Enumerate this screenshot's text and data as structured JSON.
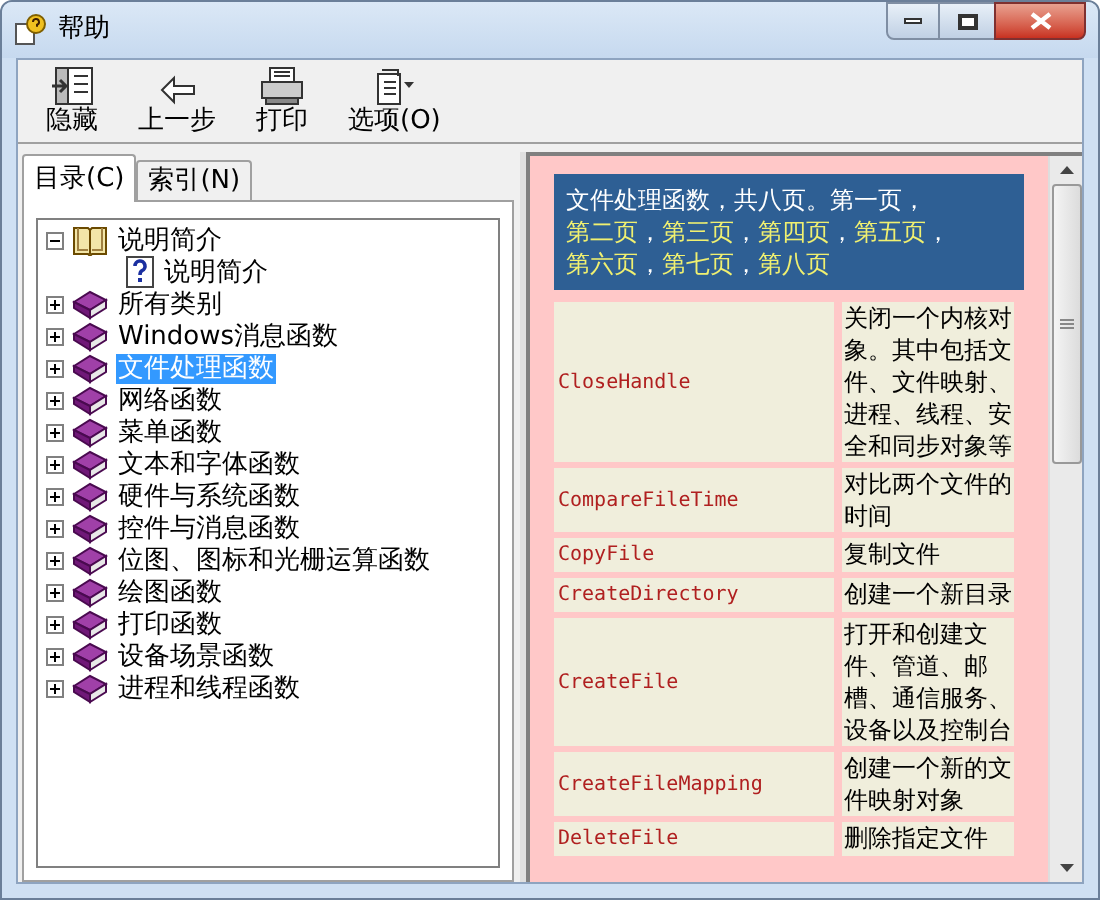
{
  "window": {
    "title": "帮助"
  },
  "toolbar": [
    {
      "label": "隐藏"
    },
    {
      "label": "上一步"
    },
    {
      "label": "打印"
    },
    {
      "label": "选项(O)"
    }
  ],
  "tabs": [
    {
      "label": "目录(C)",
      "selected": true
    },
    {
      "label": "索引(N)",
      "selected": false
    }
  ],
  "tree": [
    {
      "label": "说明简介",
      "kind": "book",
      "expanded": true,
      "selected": false,
      "children": [
        {
          "label": "说明简介",
          "kind": "page",
          "selected": false
        }
      ]
    },
    {
      "label": "所有类别",
      "kind": "book",
      "expanded": false,
      "selected": false
    },
    {
      "label": "Windows消息函数",
      "kind": "book",
      "expanded": false,
      "selected": false
    },
    {
      "label": "文件处理函数",
      "kind": "book",
      "expanded": false,
      "selected": true
    },
    {
      "label": "网络函数",
      "kind": "book",
      "expanded": false,
      "selected": false
    },
    {
      "label": "菜单函数",
      "kind": "book",
      "expanded": false,
      "selected": false
    },
    {
      "label": "文本和字体函数",
      "kind": "book",
      "expanded": false,
      "selected": false
    },
    {
      "label": "硬件与系统函数",
      "kind": "book",
      "expanded": false,
      "selected": false
    },
    {
      "label": "控件与消息函数",
      "kind": "book",
      "expanded": false,
      "selected": false
    },
    {
      "label": "位图、图标和光栅运算函数",
      "kind": "book",
      "expanded": false,
      "selected": false
    },
    {
      "label": "绘图函数",
      "kind": "book",
      "expanded": false,
      "selected": false
    },
    {
      "label": "打印函数",
      "kind": "book",
      "expanded": false,
      "selected": false
    },
    {
      "label": "设备场景函数",
      "kind": "book",
      "expanded": false,
      "selected": false
    },
    {
      "label": "进程和线程函数",
      "kind": "book",
      "expanded": false,
      "selected": false
    }
  ],
  "header": {
    "intro": "文件处理函数，共八页。第一页，",
    "separator": "，",
    "links": [
      "第二页",
      "第三页",
      "第四页",
      "第五页",
      "第六页",
      "第七页",
      "第八页"
    ]
  },
  "functions": [
    {
      "name": "CloseHandle",
      "description": "关闭一个内核对象。其中包括文件、文件映射、进程、线程、安全和同步对象等"
    },
    {
      "name": "CompareFileTime",
      "description": "对比两个文件的时间"
    },
    {
      "name": "CopyFile",
      "description": "复制文件"
    },
    {
      "name": "CreateDirectory",
      "description": "创建一个新目录"
    },
    {
      "name": "CreateFile",
      "description": "打开和创建文件、管道、邮槽、通信服务、设备以及控制台"
    },
    {
      "name": "CreateFileMapping",
      "description": "创建一个新的文件映射对象"
    },
    {
      "name": "DeleteFile",
      "description": "删除指定文件"
    }
  ]
}
